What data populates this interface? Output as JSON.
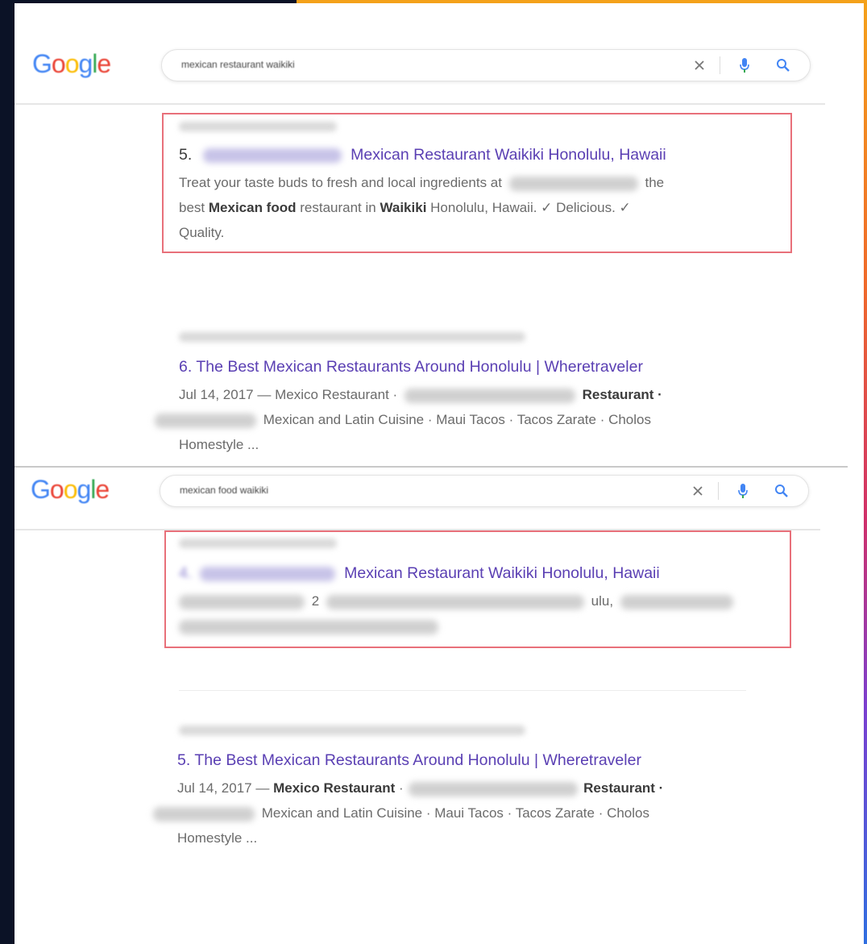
{
  "panels": [
    {
      "logo": "Google",
      "query": "mexican restaurant waikiki",
      "results": [
        {
          "number": "5.",
          "title": "Mexican Restaurant Waikiki Honolulu, Hawaii",
          "snippet": {
            "line1_a": "Treat your taste buds to fresh and local ingredients at",
            "line1_b": "the",
            "line2_a": "best",
            "line2_b": "Mexican food",
            "line2_c": "restaurant in",
            "line2_d": "Waikiki",
            "line2_e": "Honolulu, Hawaii. ✓ Delicious. ✓",
            "line3": "Quality."
          },
          "highlighted": true
        },
        {
          "number": "6.",
          "title": "The Best Mexican Restaurants Around Honolulu | Wheretraveler",
          "snippet": {
            "line1_a": "Jul 14, 2017 — Mexico Restaurant ·",
            "line1_b": "Restaurant ·",
            "line2": "Mexican and Latin Cuisine · Maui Tacos · Tacos Zarate · Cholos",
            "line3": "Homestyle ..."
          },
          "highlighted": false
        }
      ]
    },
    {
      "logo": "Google",
      "query": "mexican food waikiki",
      "results": [
        {
          "number": "4.",
          "title": "Mexican Restaurant Waikiki Honolulu, Hawaii",
          "snippet": {
            "line1_a": "2",
            "line1_b": "ulu,"
          },
          "highlighted": true
        },
        {
          "number": "5.",
          "title": "The Best Mexican Restaurants Around Honolulu | Wheretraveler",
          "snippet": {
            "line1_a": "Jul 14, 2017 —",
            "line1_b": "Mexico Restaurant",
            "line1_c": "·",
            "line1_d": "Restaurant ·",
            "line2": "Mexican and Latin Cuisine · Maui Tacos · Tacos Zarate · Cholos",
            "line3": "Homestyle ..."
          },
          "highlighted": false
        }
      ]
    }
  ],
  "icons": {
    "clear": "close-icon",
    "voice": "microphone-icon",
    "search": "search-icon"
  },
  "colors": {
    "accent_orange": "#f4a11a",
    "frame_dark": "#0b1226",
    "result_link": "#5a3fb3",
    "highlight_box": "#e8707a",
    "google_blue": "#4285f4",
    "google_red": "#ea4335",
    "google_yellow": "#fbbc05",
    "google_green": "#34a853"
  }
}
